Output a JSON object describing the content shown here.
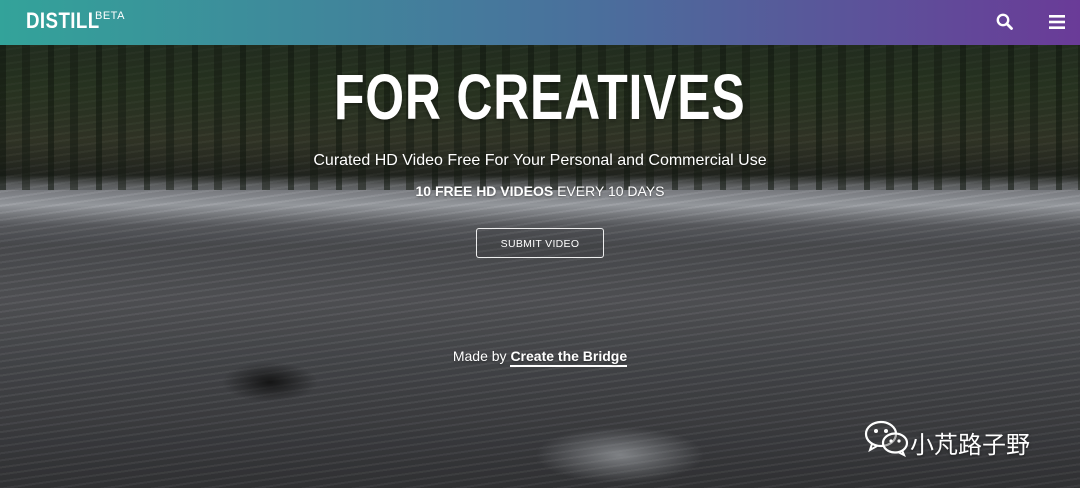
{
  "nav": {
    "logo": "DISTILL",
    "beta": "BETA",
    "icons": [
      "search-icon",
      "menu-icon"
    ],
    "gradient_start": "#33a39a",
    "gradient_end": "#6a3b98"
  },
  "hero": {
    "headline": "FOR CREATIVES",
    "subtitle": "Curated HD Video Free For Your Personal and Commercial Use",
    "promo_bold": "10 FREE HD VIDEOS",
    "promo_rest": " EVERY 10 DAYS",
    "submit_label": "SUBMIT VIDEO",
    "credit_prefix": "Made by ",
    "credit_link": "Create the Bridge"
  },
  "watermark": {
    "text": "小芃路子野",
    "icon": "wechat-icon"
  }
}
